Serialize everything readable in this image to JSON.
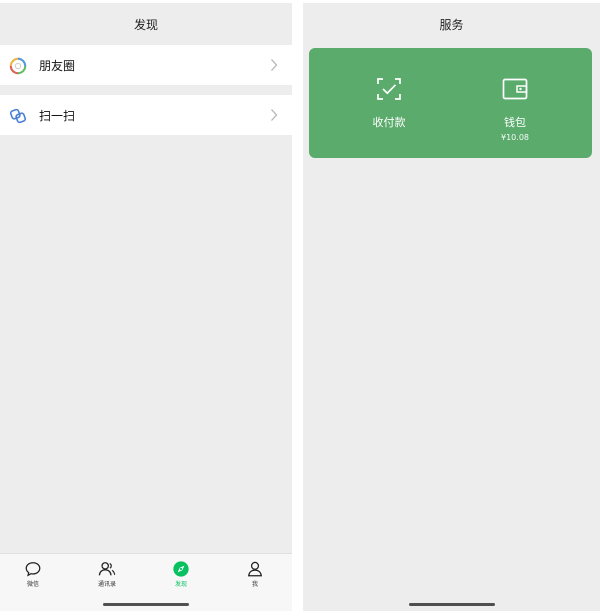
{
  "discover": {
    "title": "发现",
    "items": [
      {
        "label": "朋友圈"
      },
      {
        "label": "扫一扫"
      }
    ],
    "tabbar": [
      {
        "label": "微信"
      },
      {
        "label": "通讯录"
      },
      {
        "label": "发现"
      },
      {
        "label": "我"
      }
    ],
    "active_tab": "发现"
  },
  "services": {
    "title": "服务",
    "actions": [
      {
        "label": "收付款",
        "icon": "scan-check-icon"
      },
      {
        "label": "钱包",
        "sub": "¥10.08",
        "icon": "wallet-icon"
      }
    ]
  },
  "colors": {
    "accent": "#07c160",
    "card": "#5aab6c",
    "background": "#ededed"
  }
}
